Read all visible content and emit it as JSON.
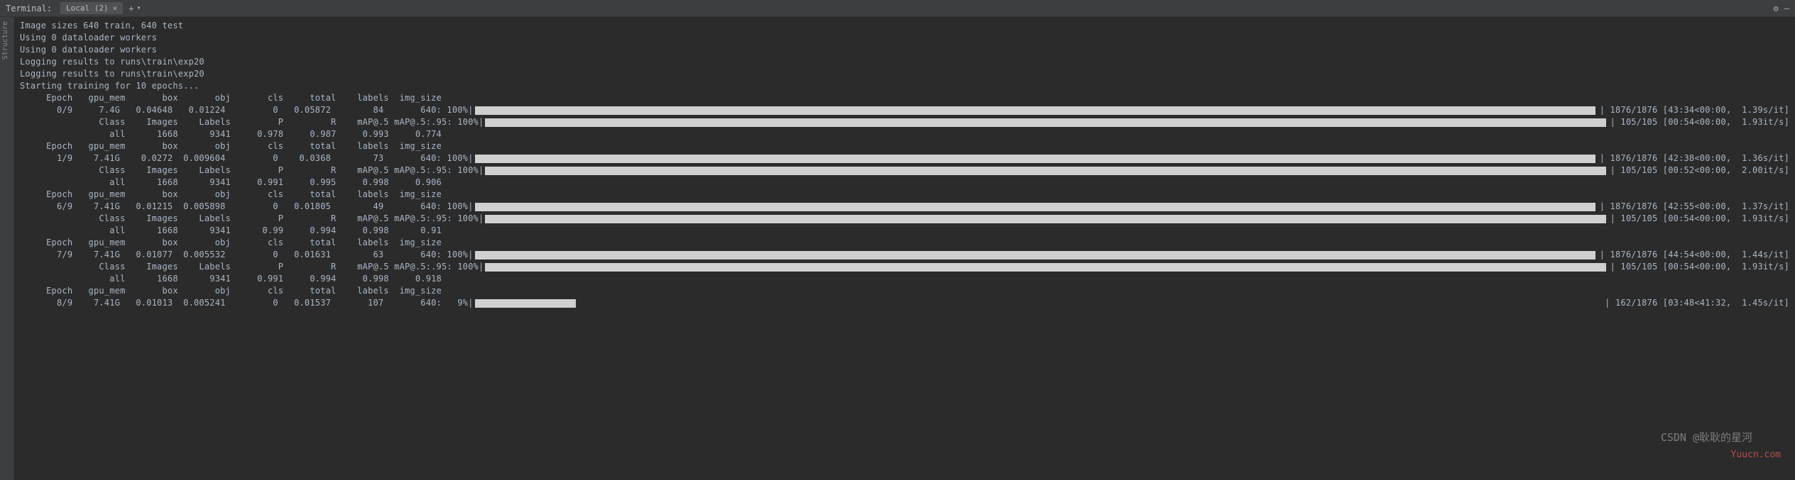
{
  "titlebar": {
    "label": "Terminal:",
    "tab_label": "Local (2)",
    "plus": "+",
    "down": "▾",
    "gear": "⚙",
    "minimize": "—"
  },
  "sidebar": {
    "structure": "Structure"
  },
  "log_lines": [
    "Image sizes 640 train, 640 test",
    "Using 0 dataloader workers",
    "Using 0 dataloader workers",
    "Logging results to runs\\train\\exp20",
    "Logging results to runs\\train\\exp20",
    "Starting training for 10 epochs...",
    ""
  ],
  "epochs": [
    {
      "header": "     Epoch   gpu_mem       box       obj       cls     total    labels  img_size",
      "train": "       0/9     7.4G   0.04648   0.01224         0   0.05872        84       640: 100%|",
      "train_suffix": "| 1876/1876 [43:34<00:00,  1.39s/it]",
      "header2": "               Class    Images    Labels         P         R    mAP@.5 mAP@.5:.95: 100%|",
      "val_suffix": "| 105/105 [00:54<00:00,  1.93it/s]",
      "metrics": "                 all      1668      9341     0.978     0.987     0.993     0.774"
    },
    {
      "header": "     Epoch   gpu_mem       box       obj       cls     total    labels  img_size",
      "train": "       1/9    7.41G    0.0272  0.009604         0    0.0368        73       640: 100%|",
      "train_suffix": "| 1876/1876 [42:38<00:00,  1.36s/it]",
      "header2": "               Class    Images    Labels         P         R    mAP@.5 mAP@.5:.95: 100%|",
      "val_suffix": "| 105/105 [00:52<00:00,  2.00it/s]",
      "metrics": "                 all      1668      9341     0.991     0.995     0.998     0.906"
    },
    {
      "header": "     Epoch   gpu_mem       box       obj       cls     total    labels  img_size",
      "train": "       6/9    7.41G   0.01215  0.005898         0   0.01805        49       640: 100%|",
      "train_suffix": "| 1876/1876 [42:55<00:00,  1.37s/it]",
      "header2": "               Class    Images    Labels         P         R    mAP@.5 mAP@.5:.95: 100%|",
      "val_suffix": "| 105/105 [00:54<00:00,  1.93it/s]",
      "metrics": "                 all      1668      9341      0.99     0.994     0.998      0.91"
    },
    {
      "header": "     Epoch   gpu_mem       box       obj       cls     total    labels  img_size",
      "train": "       7/9    7.41G   0.01077  0.005532         0   0.01631        63       640: 100%|",
      "train_suffix": "| 1876/1876 [44:54<00:00,  1.44s/it]",
      "header2": "               Class    Images    Labels         P         R    mAP@.5 mAP@.5:.95: 100%|",
      "val_suffix": "| 105/105 [00:54<00:00,  1.93it/s]",
      "metrics": "                 all      1668      9341     0.991     0.994     0.998     0.918"
    }
  ],
  "current": {
    "header": "     Epoch   gpu_mem       box       obj       cls     total    labels  img_size",
    "train": "       8/9    7.41G   0.01013  0.005241         0   0.01537       107       640:   9%|",
    "train_suffix": "| 162/1876 [03:48<41:32,  1.45s/it]",
    "percent": 9
  },
  "watermarks": {
    "csdn": "CSDN @耿耿的星河",
    "yuucn": "Yuucn.com"
  }
}
